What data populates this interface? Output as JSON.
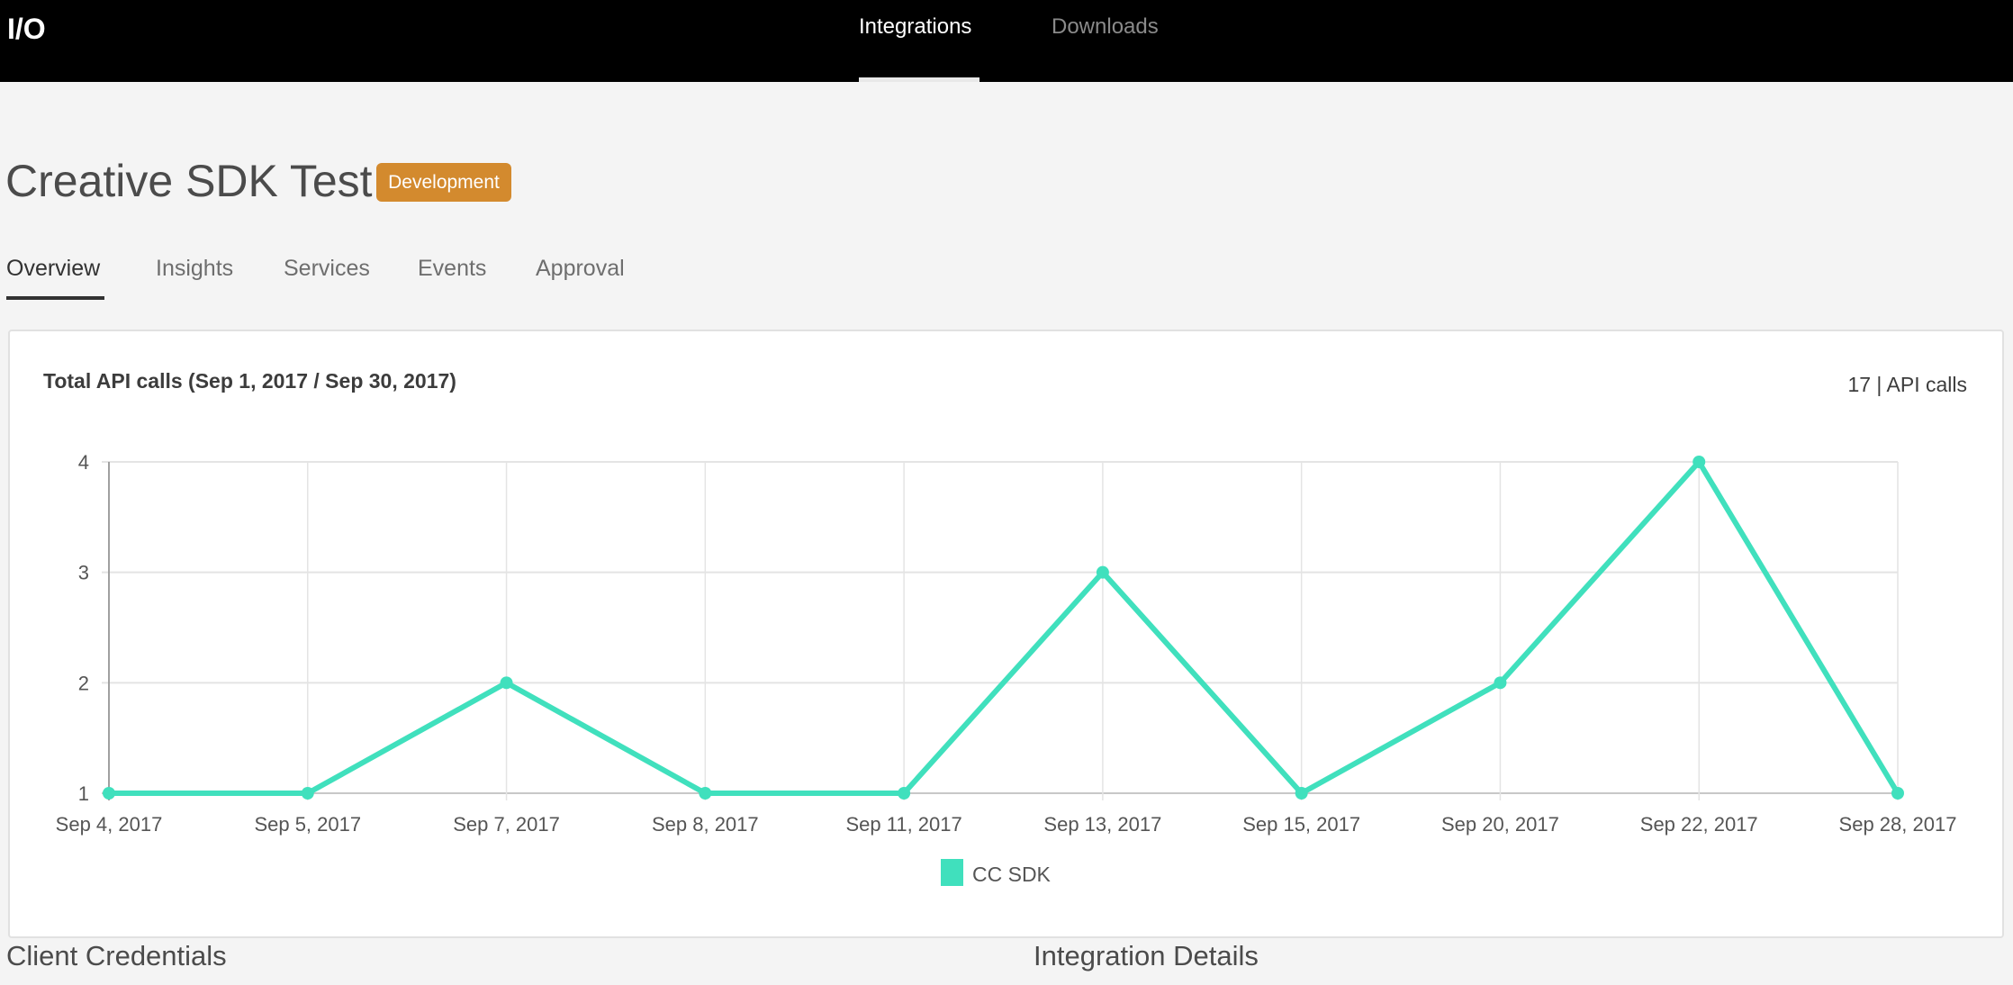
{
  "header": {
    "logo": "I/O",
    "nav": [
      {
        "label": "Integrations",
        "active": true
      },
      {
        "label": "Downloads",
        "active": false
      }
    ]
  },
  "page": {
    "title": "Creative SDK Test",
    "badge": "Development",
    "badge_color": "#d38a2e",
    "tabs": [
      {
        "label": "Overview",
        "active": true
      },
      {
        "label": "Insights"
      },
      {
        "label": "Services"
      },
      {
        "label": "Events"
      },
      {
        "label": "Approval"
      }
    ]
  },
  "card": {
    "title": "Total API calls (Sep 1, 2017 / Sep 30, 2017)",
    "total": "17 | API calls"
  },
  "chart_data": {
    "type": "line",
    "title": "Total API calls (Sep 1, 2017 / Sep 30, 2017)",
    "categories": [
      "Sep 4, 2017",
      "Sep 5, 2017",
      "Sep 7, 2017",
      "Sep 8, 2017",
      "Sep 11, 2017",
      "Sep 13, 2017",
      "Sep 15, 2017",
      "Sep 20, 2017",
      "Sep 22, 2017",
      "Sep 28, 2017"
    ],
    "series": [
      {
        "name": "CC SDK",
        "values": [
          1,
          1,
          2,
          1,
          1,
          3,
          1,
          2,
          4,
          1
        ],
        "color": "#40e0bd"
      }
    ],
    "ylim": [
      1,
      4
    ],
    "yticks": [
      1,
      2,
      3,
      4
    ],
    "grid": true,
    "legend": "bottom"
  },
  "sections": {
    "left": "Client Credentials",
    "right": "Integration Details"
  }
}
